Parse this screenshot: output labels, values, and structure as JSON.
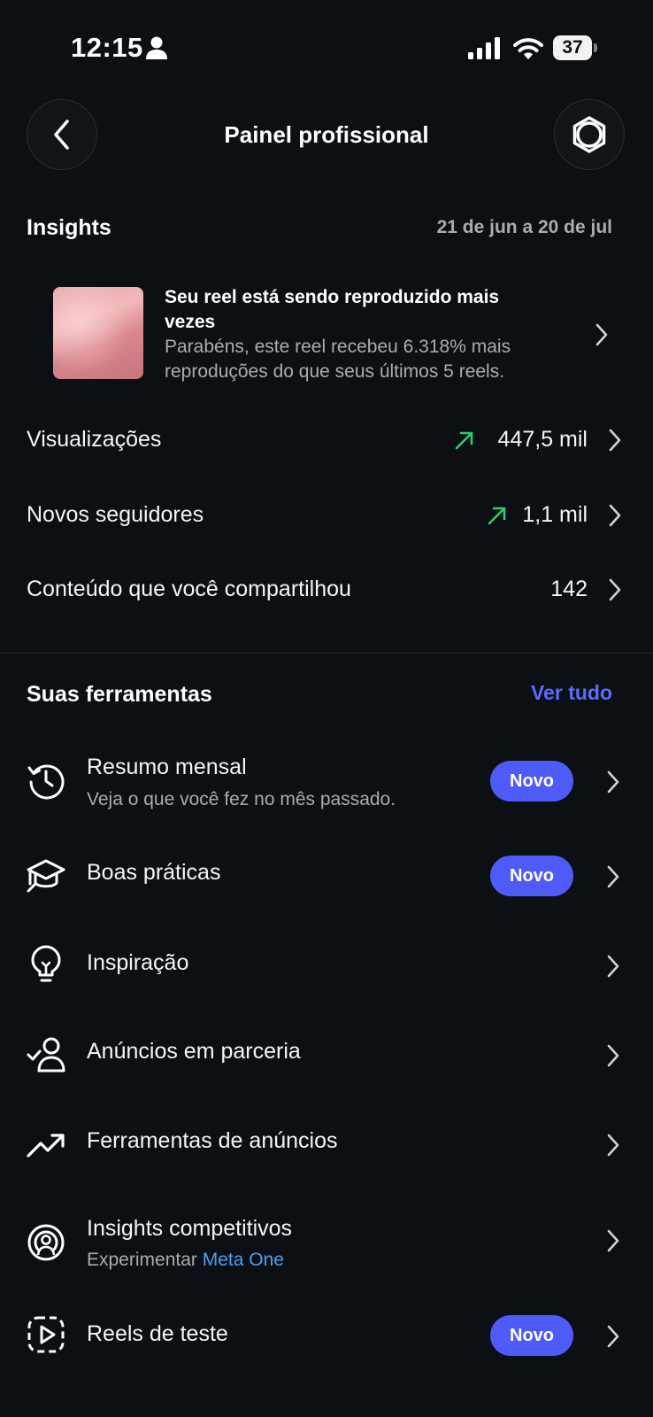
{
  "status_bar": {
    "time": "12:15",
    "battery": "37"
  },
  "header": {
    "title": "Painel profissional"
  },
  "insights": {
    "title": "Insights",
    "date_range": "21 de jun a 20 de jul",
    "reel_card": {
      "title": "Seu reel está sendo reproduzido mais vezes",
      "description": "Parabéns, este reel recebeu 6.318% mais reproduções do que seus últimos 5 reels."
    },
    "metrics": [
      {
        "label": "Visualizações",
        "value": "447,5 mil",
        "trend": "up"
      },
      {
        "label": "Novos seguidores",
        "value": "1,1 mil",
        "trend": "up"
      },
      {
        "label": "Conteúdo que você compartilhou",
        "value": "142",
        "trend": "none"
      }
    ]
  },
  "tools": {
    "title": "Suas ferramentas",
    "see_all": "Ver tudo",
    "items": [
      {
        "title": "Resumo mensal",
        "subtitle": "Veja o que você fez no mês passado.",
        "badge": "Novo",
        "icon": "history-clock-icon"
      },
      {
        "title": "Boas práticas",
        "badge": "Novo",
        "icon": "graduation-cap-icon"
      },
      {
        "title": "Inspiração",
        "icon": "lightbulb-icon"
      },
      {
        "title": "Anúncios em parceria",
        "icon": "person-check-icon"
      },
      {
        "title": "Ferramentas de anúncios",
        "icon": "trending-up-icon"
      },
      {
        "title": "Insights competitivos",
        "subtitle_prefix": "Experimentar",
        "subtitle_link": "Meta One",
        "icon": "radar-person-icon"
      },
      {
        "title": "Reels de teste",
        "badge": "Novo",
        "icon": "reel-test-icon"
      }
    ]
  },
  "colors": {
    "background": "#0c1014",
    "accent": "#4f5bf7",
    "link": "#4a9ff5",
    "trend_up": "#2ecc71"
  }
}
